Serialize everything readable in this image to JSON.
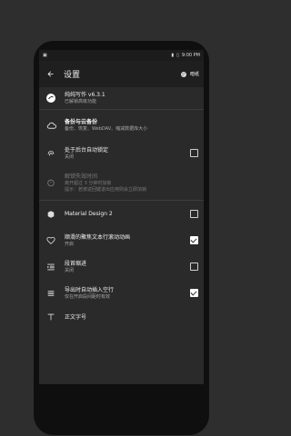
{
  "status": {
    "time": "9:00 PM"
  },
  "header": {
    "title": "设置",
    "theme_label": "暗纸"
  },
  "items": [
    {
      "main": "纯纯写作 v6.3.1",
      "sub": "已解锁高级功能"
    },
    {
      "main": "备份与云备份",
      "sub": "备份、恢复、WebDAV、缩减数据库大小"
    },
    {
      "main": "处于后台自动锁定",
      "sub": "关闭"
    },
    {
      "main": "解锁失效时间",
      "sub": "离开超过 3 分钟时加锁",
      "sub2": "提示：若按返回键退出应用则会立即加锁"
    },
    {
      "main": "Material Design 2",
      "sub": ""
    },
    {
      "main": "顺滑的聚焦文本行滚动动画",
      "sub": "开启"
    },
    {
      "main": "段首缩进",
      "sub": "关闭"
    },
    {
      "main": "导出时自动插入空行",
      "sub": "仅在开启段间距时有效"
    },
    {
      "main": "正文字号",
      "sub": ""
    }
  ],
  "icons": [
    "back-arrow-icon",
    "palette-icon",
    "app-logo-icon",
    "cloud-icon",
    "fingerprint-icon",
    "timer-icon",
    "material-icon",
    "heart-icon",
    "indent-icon",
    "list-icon",
    "text-size-icon"
  ],
  "checks": [
    false,
    false,
    true,
    false,
    true
  ]
}
